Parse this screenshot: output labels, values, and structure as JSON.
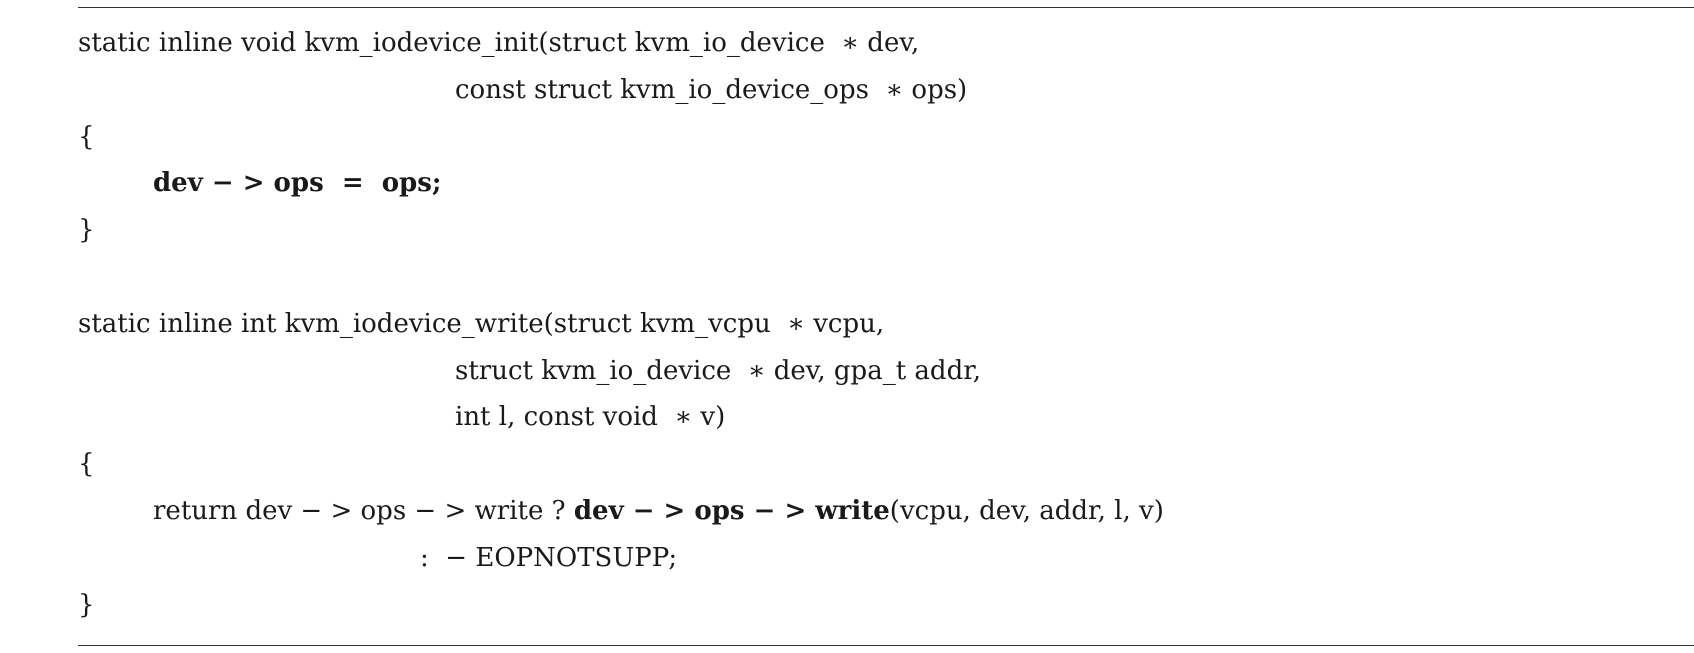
{
  "code": {
    "block1": {
      "line1": "static inline void kvm_iodevice_init(struct kvm_io_device  ∗ dev,",
      "line2": "const struct kvm_io_device_ops  ∗ ops)",
      "line3": "{",
      "line4_bold": "dev − > ops  =  ops;",
      "line5": "}"
    },
    "block2": {
      "line1": "static inline int kvm_iodevice_write(struct kvm_vcpu  ∗ vcpu,",
      "line2": "struct kvm_io_device  ∗ dev, gpa_t addr,",
      "line3": "int l, const void  ∗ v)",
      "line4": "{",
      "line5_prefix": "return dev − > ops − > write ? ",
      "line5_bold": "dev − > ops − > write",
      "line5_suffix": "(vcpu, dev, addr, l, v)",
      "line6": ":  − EOPNOTSUPP;",
      "line7": "}"
    }
  }
}
